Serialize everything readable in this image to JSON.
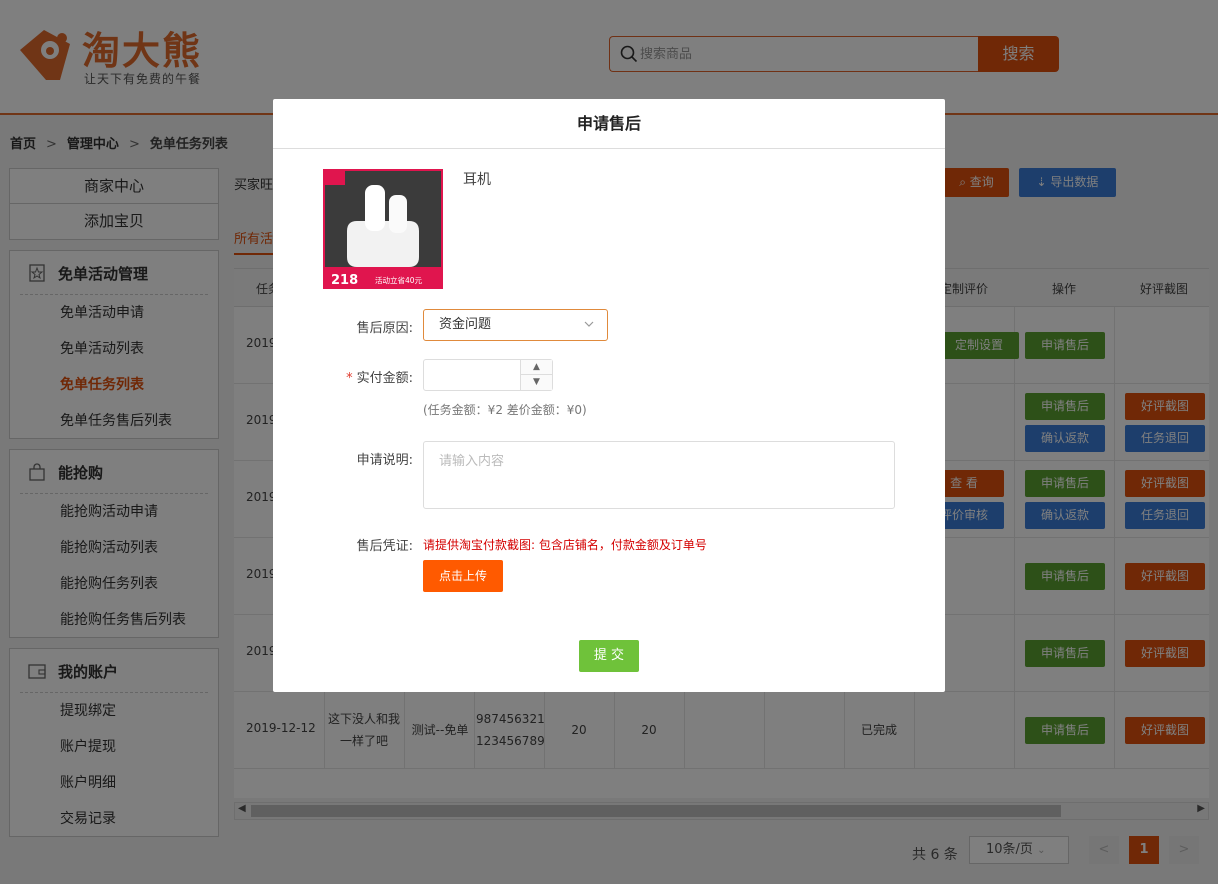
{
  "header": {
    "logo_name": "淘大熊",
    "logo_slogan": "让天下有免费的午餐",
    "search_placeholder": "搜索商品",
    "search_button": "搜索"
  },
  "breadcrumb": {
    "home": "首页",
    "sep": ">",
    "manage": "管理中心",
    "current": "免单任务列表"
  },
  "sidebar": {
    "top_items": [
      "商家中心",
      "添加宝贝"
    ],
    "groups": [
      {
        "title": "免单活动管理",
        "items": [
          "免单活动申请",
          "免单活动列表",
          "免单任务列表",
          "免单任务售后列表"
        ]
      },
      {
        "title": "能抢购",
        "items": [
          "能抢购活动申请",
          "能抢购活动列表",
          "能抢购任务列表",
          "能抢购任务售后列表"
        ]
      },
      {
        "title": "我的账户",
        "items": [
          "提现绑定",
          "账户提现",
          "账户明细",
          "交易记录"
        ]
      }
    ]
  },
  "main": {
    "filter_label": "买家旺",
    "query_button": "查询",
    "export_button": "导出数据",
    "tab_active": "所有活",
    "headers": {
      "col1": "任务",
      "custom_review": "定制评价",
      "operation": "操作",
      "screenshot": "好评截图"
    },
    "rows": [
      {
        "date": "2019",
        "custom": "定制设置",
        "op1": "申请售后"
      },
      {
        "date": "2019",
        "op1": "申请售后",
        "op2": "确认返款",
        "shot1": "好评截图",
        "shot2": "任务退回"
      },
      {
        "date": "2019",
        "custom1": "查 看",
        "custom2": "评价审核",
        "op1": "申请售后",
        "op2": "确认返款",
        "shot1": "好评截图",
        "shot2": "任务退回"
      },
      {
        "date": "2019",
        "op1": "申请售后",
        "shot1": "好评截图"
      },
      {
        "date": "2019",
        "op1": "申请售后",
        "shot1": "好评截图"
      },
      {
        "date": "2019-12-12",
        "title1": "这下没人和我",
        "title2": "一样了吧",
        "activity": "测试--免单",
        "num1": "987456321",
        "num2": "123456789",
        "price": "20",
        "amount": "20",
        "status": "已完成",
        "op1": "申请售后",
        "shot1": "好评截图"
      }
    ],
    "pager": {
      "total": "共 6 条",
      "page_size": "10条/页",
      "current": "1",
      "prev": "<",
      "next": ">"
    }
  },
  "modal": {
    "title": "申请售后",
    "product_name": "耳机",
    "product_badge": "活动立省40元",
    "product_price": "218",
    "reason_label": "售后原因:",
    "reason_value": "资金问题",
    "amount_label": "实付金额:",
    "amount_required": "*",
    "amount_hint": "(任务金额：¥2   差价金额：¥0)",
    "desc_label": "申请说明:",
    "desc_placeholder": "请输入内容",
    "proof_label": "售后凭证:",
    "proof_hint": "请提供淘宝付款截图: 包含店铺名，付款金额及订单号",
    "upload_button": "点击上传",
    "submit_button": "提 交"
  },
  "colors": {
    "brand": "#e0500c",
    "green": "#5aa130",
    "blue": "#3a7dd8",
    "submit": "#6fc23a"
  }
}
